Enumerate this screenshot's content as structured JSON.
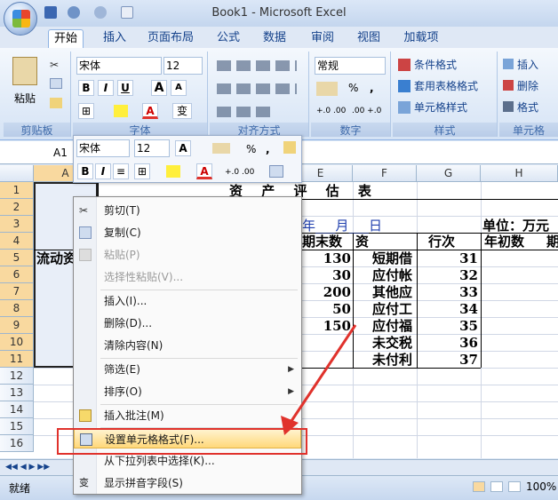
{
  "window": {
    "title": "Book1 - Microsoft Excel"
  },
  "ribbon": {
    "tabs": [
      "开始",
      "插入",
      "页面布局",
      "公式",
      "数据",
      "审阅",
      "视图",
      "加载项"
    ],
    "clipboard": {
      "paste": "粘贴",
      "label": "剪贴板"
    },
    "font": {
      "family": "宋体",
      "size": "12",
      "bold": "B",
      "italic": "I",
      "underline": "U",
      "grow": "A",
      "shrink": "A",
      "font_color": "A",
      "label": "字体",
      "phonetic": "变"
    },
    "alignment": {
      "label": "对齐方式"
    },
    "number": {
      "format": "常规",
      "label": "数字",
      "percent": "%",
      "comma": ",",
      "inc_decimal": "+.0 .00",
      "dec_decimal": ".00 +.0"
    },
    "styles": {
      "conditional": "条件格式",
      "table_format": "套用表格格式",
      "cell_styles": "单元格样式",
      "label": "样式"
    },
    "cells": {
      "insert": "插入",
      "delete": "删除",
      "format": "格式",
      "label": "单元格"
    }
  },
  "formula_bar": {
    "name_box": "A1"
  },
  "mini_toolbar": {
    "font": "宋体",
    "size": "12",
    "percent": "%",
    "comma": ",",
    "bold": "B",
    "italic": "I",
    "font_color": "A",
    "inc_decimal": "+.0 .00"
  },
  "grid": {
    "columns": [
      "A",
      "E",
      "F",
      "G",
      "H"
    ],
    "rows": [
      "1",
      "2",
      "3",
      "4",
      "5",
      "6",
      "7",
      "8",
      "9",
      "10",
      "11",
      "12",
      "13",
      "14",
      "15",
      "16"
    ],
    "title": "资 产 评 估 表",
    "date": "年___月___日",
    "unit": "单位：万元",
    "col_e_header": "期末数",
    "col_f_header": "资",
    "col_g_header": "行次",
    "col_h_header": "年初数",
    "col_i_header": "期",
    "a5": "流动资",
    "e_values": [
      "130",
      "30",
      "200",
      "50",
      "150"
    ],
    "f_labels": [
      "短期借",
      "应付帐",
      "其他应",
      "应付工",
      "应付福",
      "未交税",
      "未付利"
    ],
    "g_values": [
      "31",
      "32",
      "33",
      "34",
      "35",
      "36",
      "37"
    ]
  },
  "context_menu": {
    "items": [
      {
        "label": "剪切(T)",
        "icon": "scissors-icon",
        "disabled": false
      },
      {
        "label": "复制(C)",
        "icon": "copy-icon",
        "disabled": false
      },
      {
        "label": "粘贴(P)",
        "icon": "paste-icon",
        "disabled": true
      },
      {
        "label": "选择性粘贴(V)...",
        "icon": "",
        "disabled": true
      },
      {
        "label": "插入(I)...",
        "icon": "",
        "disabled": false
      },
      {
        "label": "删除(D)...",
        "icon": "",
        "disabled": false
      },
      {
        "label": "清除内容(N)",
        "icon": "",
        "disabled": false
      },
      {
        "label": "筛选(E)",
        "icon": "",
        "disabled": false,
        "submenu": true
      },
      {
        "label": "排序(O)",
        "icon": "",
        "disabled": false,
        "submenu": true
      },
      {
        "label": "插入批注(M)",
        "icon": "comment-icon",
        "disabled": false
      },
      {
        "label": "设置单元格格式(F)...",
        "icon": "format-cells-icon",
        "disabled": false,
        "highlight": true
      },
      {
        "label": "从下拉列表中选择(K)...",
        "icon": "",
        "disabled": false
      },
      {
        "label": "显示拼音字段(S)",
        "icon": "phonetic-icon",
        "disabled": false
      }
    ]
  },
  "status_bar": {
    "ready": "就绪",
    "zoom": "100%"
  },
  "colors": {
    "accent": "#15428b",
    "highlight": "#ffd87a",
    "annotation": "#e0322c"
  }
}
